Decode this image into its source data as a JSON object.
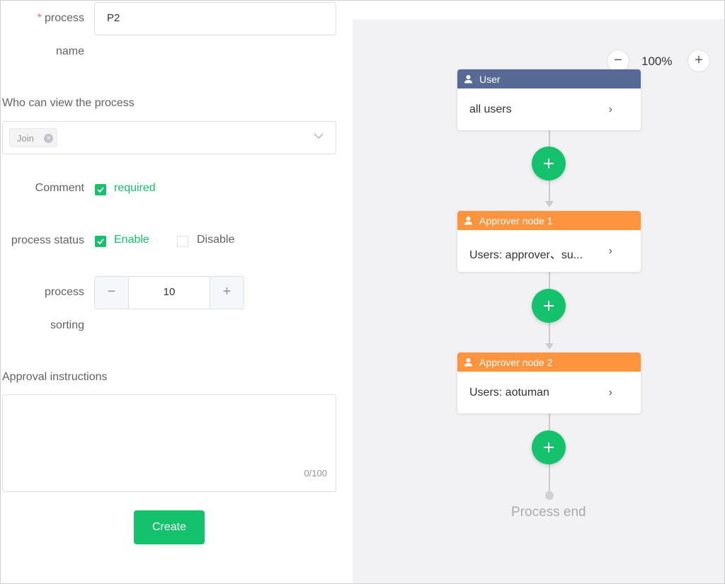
{
  "form": {
    "process_name": {
      "required_mark": "*",
      "label_line1": "process",
      "label_line2": "name",
      "value": "P2"
    },
    "viewers": {
      "label": "Who can view the process",
      "tags": [
        "Join"
      ]
    },
    "comment": {
      "label": "Comment",
      "option": "required",
      "checked": true
    },
    "status": {
      "label": "process status",
      "enable_label": "Enable",
      "disable_label": "Disable",
      "selected": "Enable"
    },
    "sorting": {
      "label_line1": "process",
      "label_line2": "sorting",
      "value": "10",
      "minus": "−",
      "plus": "+"
    },
    "instructions": {
      "label": "Approval instructions",
      "value": "",
      "counter": "0/100"
    },
    "create_label": "Create"
  },
  "canvas": {
    "zoom": {
      "level": "100%",
      "minus": "−",
      "plus": "+"
    },
    "nodes": [
      {
        "title": "User",
        "content": "all users",
        "header_color": "#576a95"
      },
      {
        "title": "Approver node 1",
        "content": "Users:  approver、su...",
        "header_color": "#ff943e"
      },
      {
        "title": "Approver node 2",
        "content": "Users:  aotuman",
        "header_color": "#ff943e"
      }
    ],
    "end_label": "Process end"
  },
  "colors": {
    "accent": "#13c26a",
    "canvas_bg": "#f2f2f4"
  }
}
